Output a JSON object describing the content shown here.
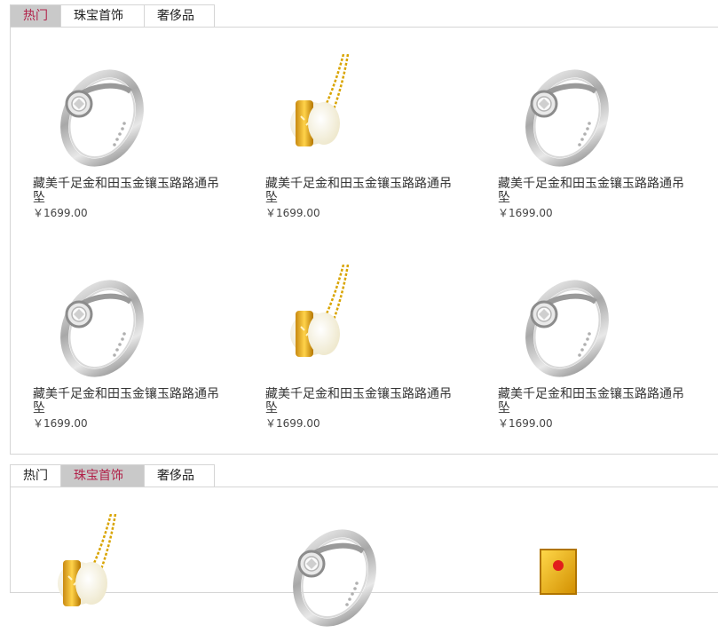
{
  "panels": [
    {
      "tabs": [
        "热门",
        "珠宝首饰",
        "奢侈品"
      ],
      "active_tab": 0,
      "items": [
        {
          "name": "藏美千足金和田玉金镶玉路路通吊坠",
          "price": "￥1699.00",
          "image": "ring"
        },
        {
          "name": "藏美千足金和田玉金镶玉路路通吊坠",
          "price": "￥1699.00",
          "image": "pendant"
        },
        {
          "name": "藏美千足金和田玉金镶玉路路通吊坠",
          "price": "￥1699.00",
          "image": "ring"
        },
        {
          "name": "藏美千足金和田玉金镶玉路路通吊坠",
          "price": "￥1699.00",
          "image": "ring"
        },
        {
          "name": "藏美千足金和田玉金镶玉路路通吊坠",
          "price": "￥1699.00",
          "image": "pendant"
        },
        {
          "name": "藏美千足金和田玉金镶玉路路通吊坠",
          "price": "￥1699.00",
          "image": "ring"
        }
      ]
    },
    {
      "tabs": [
        "热门",
        "珠宝首饰",
        "奢侈品"
      ],
      "active_tab": 1,
      "items": [
        {
          "image": "pendant"
        },
        {
          "image": "ring"
        },
        {
          "image": "gold-bar"
        }
      ]
    }
  ],
  "colors": {
    "active_tab_bg": "#c9c9c9",
    "active_tab_text": "#b2224a",
    "border": "#d5d5d5"
  }
}
